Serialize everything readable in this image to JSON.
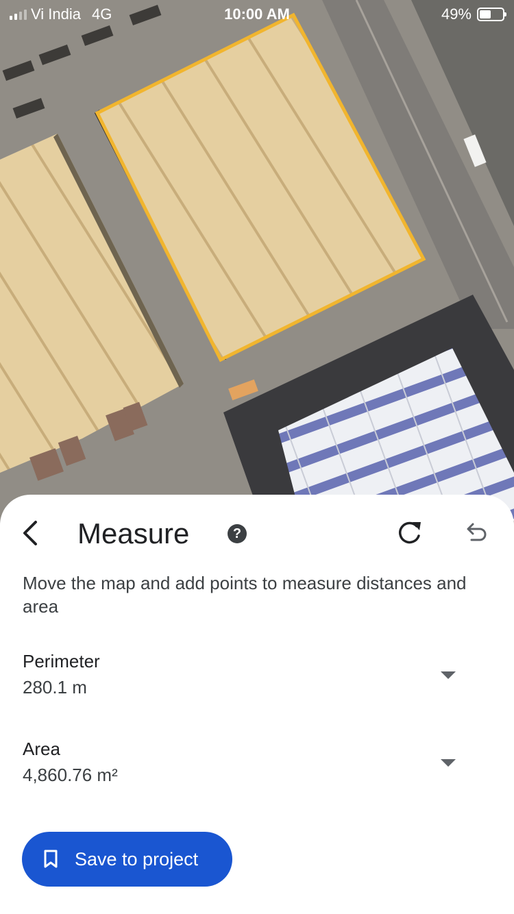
{
  "status_bar": {
    "carrier": "Vi India",
    "network": "4G",
    "time": "10:00 AM",
    "battery": "49%",
    "battery_level": 0.49
  },
  "map": {
    "measure_outline_color": "#f1b52e"
  },
  "sheet": {
    "title": "Measure",
    "help_icon": "?",
    "description": "Move the map and add points to measure distances and area",
    "metrics": [
      {
        "label": "Perimeter",
        "value": "280.1 m"
      },
      {
        "label": "Area",
        "value": "4,860.76 m²"
      }
    ],
    "save_button": {
      "label": "Save to project",
      "icon": "bookmark-icon"
    }
  },
  "colors": {
    "primary": "#1a56d1",
    "text_primary": "#202124",
    "text_secondary": "#3c4043"
  }
}
